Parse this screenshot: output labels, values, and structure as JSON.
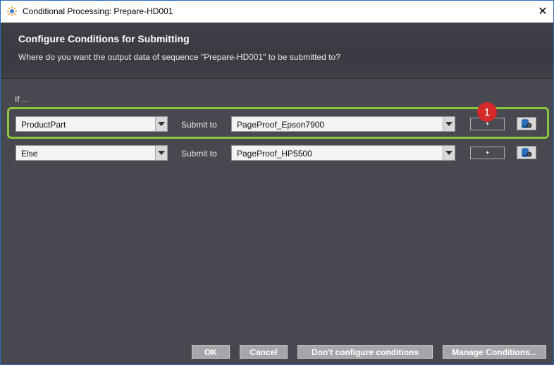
{
  "window": {
    "title": "Conditional Processing: Prepare-HD001",
    "close_symbol": "✕"
  },
  "header": {
    "title": "Configure Conditions for Submitting",
    "subtitle": "Where do you want the output data of sequence \"Prepare-HD001\" to be submitted to?"
  },
  "if_label": "If ...",
  "rows": [
    {
      "condition": "ProductPart",
      "submit_label": "Submit to",
      "target": "PageProof_Epson7900",
      "add_label": "+"
    },
    {
      "condition": "Else",
      "submit_label": "Submit to",
      "target": "PageProof_HP5500",
      "add_label": "+"
    }
  ],
  "annotation": {
    "badge_number": "1",
    "highlight_color": "#8cc63f",
    "badge_color": "#d42a2a"
  },
  "footer": {
    "ok_label": "OK",
    "cancel_label": "Cancel",
    "dont_configure_label": "Don't configure conditions",
    "manage_label": "Manage Conditions..."
  },
  "icons": {
    "app": "gear-sparkle-icon",
    "database": "database-gear-icon",
    "close": "close-icon"
  },
  "colors": {
    "background": "#484850",
    "header_background": "#3a3a42",
    "window_border": "#2b6cb5",
    "button_background": "#a6a6aa"
  }
}
